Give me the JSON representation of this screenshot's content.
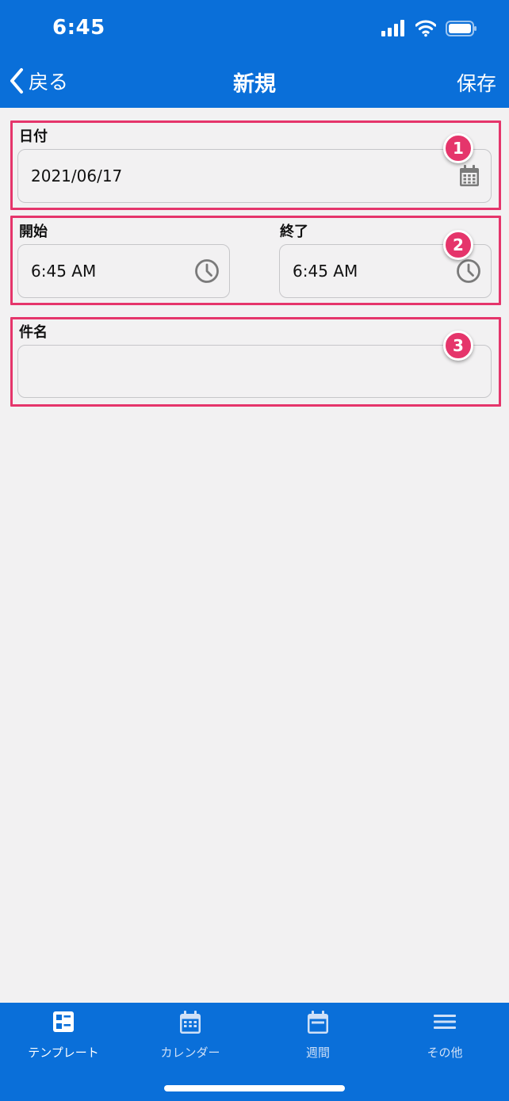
{
  "status_bar": {
    "time": "6:45"
  },
  "nav": {
    "back_label": "戻る",
    "title": "新規",
    "save_label": "保存"
  },
  "form": {
    "date": {
      "label": "日付",
      "value": "2021/06/17"
    },
    "start": {
      "label": "開始",
      "value": "6:45 AM"
    },
    "end": {
      "label": "終了",
      "value": "6:45 AM"
    },
    "subject": {
      "label": "件名",
      "value": ""
    }
  },
  "annotations": {
    "badge1": "1",
    "badge2": "2",
    "badge3": "3"
  },
  "tabs": [
    {
      "label": "テンプレート",
      "icon": "template-icon"
    },
    {
      "label": "カレンダー",
      "icon": "calendar-icon"
    },
    {
      "label": "週間",
      "icon": "week-icon"
    },
    {
      "label": "その他",
      "icon": "menu-icon"
    }
  ],
  "colors": {
    "primary": "#0a6fd9",
    "annotation": "#e5356b",
    "background": "#f2f1f2"
  }
}
